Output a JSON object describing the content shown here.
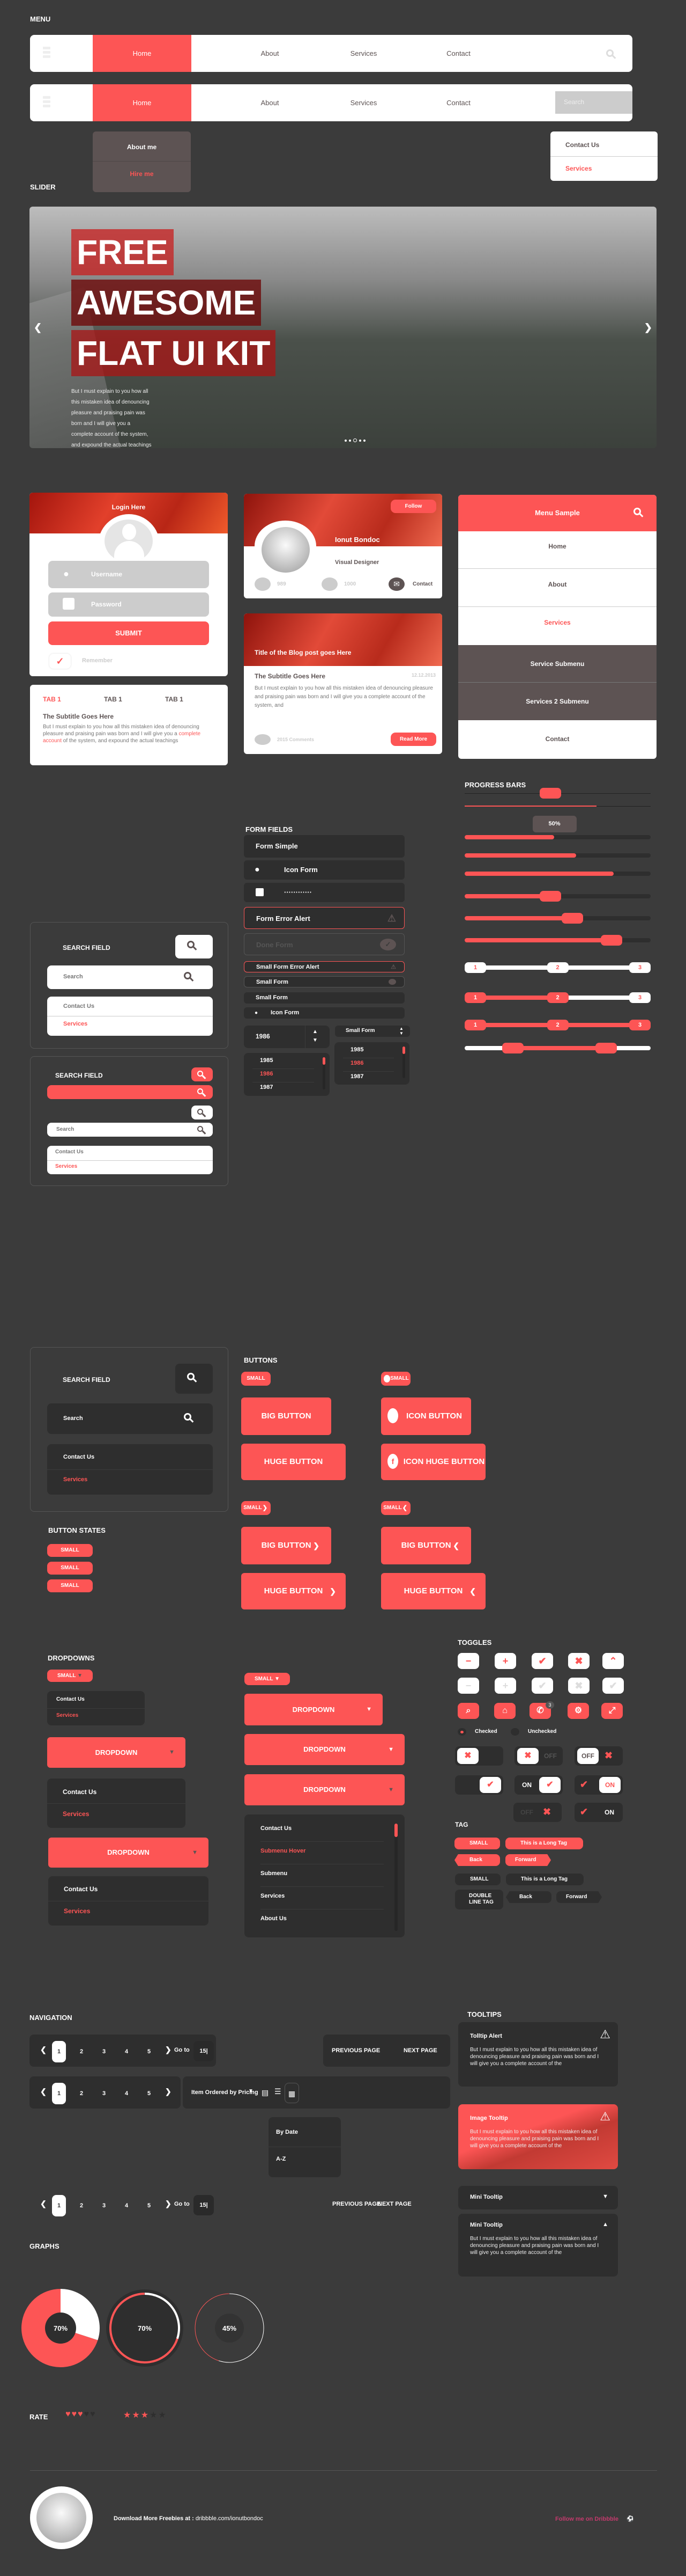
{
  "sections": {
    "menu": "MENU",
    "slider": "SLIDER",
    "progress": "PROGRESS BARS",
    "form_fields": "FORM FIELDS",
    "buttons": "BUTTONS",
    "button_states": "BUTTON STATES",
    "dropdowns": "DROPDOWNS",
    "toggles": "TOGGLES",
    "tag": "TAG",
    "navigation": "NAVIGATION",
    "tooltips": "TOOLTIPS",
    "graphs": "GRAPHS",
    "rate": "RATE"
  },
  "colors": {
    "accent": "#fd5555",
    "background": "#3b3b3b",
    "panel": "#2e2e2e",
    "submenu": "#5d5353"
  },
  "menu": {
    "items": [
      "Home",
      "About",
      "Services",
      "Contact"
    ],
    "active": "Home",
    "search_placeholder": "Search",
    "home_submenu": [
      "About me",
      "Hire me"
    ],
    "search_dropdown": [
      "Contact Us",
      "Services"
    ]
  },
  "slider": {
    "title_lines": [
      "FREE",
      "AWESOME",
      "FLAT UI KIT"
    ],
    "body": "But I must explain to you how all this mistaken idea of denouncing pleasure and praising pain was born and I will give you a complete account of the system, and expound the actual teachings",
    "dots": 5,
    "active_dot": 2
  },
  "login": {
    "title": "Login Here",
    "username_placeholder": "Username",
    "password_placeholder": "Password",
    "submit": "SUBMIT",
    "remember": "Remember",
    "remember_checked": true
  },
  "tabs": {
    "labels": [
      "TAB 1",
      "TAB 1",
      "TAB 1"
    ],
    "subtitle": "The Subtitle Goes Here",
    "body_before": "But I must explain to you how all this mistaken idea of denouncing pleasure and praising pain was born and I will give you a ",
    "body_link": "complete account",
    "body_after": " of the system, and expound the actual teachings"
  },
  "profile": {
    "follow": "Follow",
    "name": "Ionut Bondoc",
    "role": "Visual Designer",
    "twitter_count": "989",
    "facebook_count": "1000",
    "contact": "Contact"
  },
  "blog": {
    "title": "Title of the Blog post goes Here",
    "subtitle": "The Subtitle Goes Here",
    "date": "12.12.2013",
    "body": "But I must explain to you how all this mistaken idea of denouncing pleasure and praising pain was born and I will give you a complete account of the system, and",
    "comments": "2015 Comments",
    "read_more": "Read More"
  },
  "menu_sample": {
    "title": "Menu Sample",
    "items": [
      "Home",
      "About",
      "Services"
    ],
    "submenu": [
      "Service Submenu",
      "Services 2 Submenu"
    ],
    "last": "Contact"
  },
  "progress": {
    "slider_value": 0.46,
    "thin_bar": 0.71,
    "tooltip": "50%",
    "bars": [
      0.48,
      0.6,
      0.8
    ],
    "sliders": [
      0.46,
      0.58,
      0.79
    ],
    "steps": [
      "1",
      "2",
      "3"
    ],
    "step_active": [
      0,
      2,
      3
    ],
    "range": [
      0.26,
      0.76
    ]
  },
  "search_fields": [
    {
      "title": "SEARCH FIELD",
      "placeholder": "Search",
      "options": [
        "Contact Us",
        "Services"
      ]
    },
    {
      "title": "SEARCH FIELD",
      "placeholder": "Search",
      "options": [
        "Contact Us",
        "Services"
      ]
    },
    {
      "title": "SEARCH FIELD",
      "placeholder": "Search",
      "options": [
        "Contact Us",
        "Services"
      ]
    }
  ],
  "forms": {
    "simple": "Form Simple",
    "icon": "Icon Form",
    "password": "············",
    "error": "Form Error Alert",
    "done": "Done Form",
    "small_error": "Small Form Error Alert",
    "small_done": "Small Form",
    "small": "Small Form",
    "small_icon": "Icon Form",
    "year_value": "1986",
    "small_select": "Small Form",
    "years": [
      "1985",
      "1986",
      "1987"
    ],
    "selected_year": "1986"
  },
  "buttons": {
    "small": "SMALL",
    "big": "BIG BUTTON",
    "huge": "HUGE BUTTON",
    "icon": "ICON BUTTON",
    "icon_huge": "ICON HUGE BUTTON"
  },
  "button_states": [
    "SMALL",
    "SMALL",
    "SMALL"
  ],
  "dropdowns": {
    "small": "SMALL",
    "label": "DROPDOWN",
    "options": [
      "Contact Us",
      "Services"
    ],
    "long_options": [
      "Contact Us",
      "Submenu Hover",
      "Submenu",
      "Services",
      "About Us"
    ]
  },
  "toggles": {
    "checked": "Checked",
    "unchecked": "Unchecked",
    "on": "ON",
    "off": "OFF",
    "badge": "3"
  },
  "tags": {
    "small": "SMALL",
    "long": "This is a Long Tag",
    "back": "Back",
    "forward": "Forward",
    "double": "DOUBLE LINE TAG"
  },
  "navigation": {
    "pages": [
      "1",
      "2",
      "3",
      "4",
      "5"
    ],
    "current": "1",
    "goto": "Go to",
    "goto_value": "15|",
    "prev": "PREVIOUS PAGE",
    "next": "NEXT PAGE",
    "sort": "Item Ordered by Pricing",
    "sort_options": [
      "By Date",
      "A-Z"
    ]
  },
  "tooltips": {
    "alert_title": "Tolltip Alert",
    "image_title": "Image Tooltip",
    "mini_title": "Mini Tooltip",
    "body": "But I must explain to you how all this mistaken idea of denouncing pleasure and praising pain was born and I will give you a complete account of the"
  },
  "chart_data": [
    {
      "type": "pie",
      "title": "",
      "values": [
        70,
        30
      ],
      "label": "70%"
    },
    {
      "type": "pie",
      "title": "",
      "values": [
        70,
        30
      ],
      "label": "70%"
    },
    {
      "type": "pie",
      "title": "",
      "values": [
        45,
        55
      ],
      "label": "45%"
    }
  ],
  "rate": {
    "hearts": 3,
    "hearts_max": 5,
    "stars": 3,
    "stars_max": 5
  },
  "footer": {
    "download_bold": "Download More Freebies at :",
    "download_link": "dribbble.com/ionutbondoc",
    "follow": "Follow me on Dribbble"
  }
}
